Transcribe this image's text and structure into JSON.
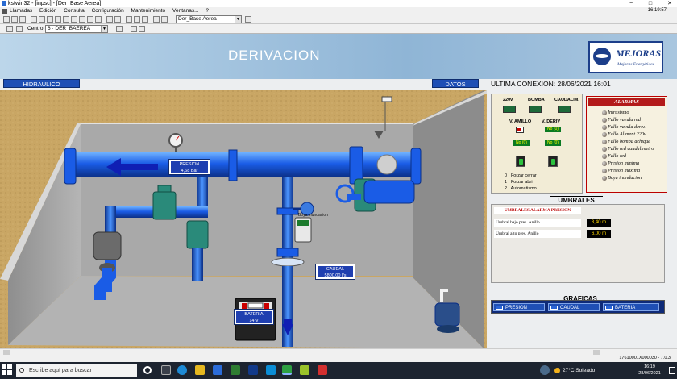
{
  "window": {
    "title": "kstwin32 - [inpsc] - [Der_Base Aerea]",
    "controls": [
      "−",
      "□",
      "✕"
    ]
  },
  "menu": {
    "items": [
      "Llamadas",
      "Edición",
      "Consulta",
      "Configuración",
      "Mantenimiento",
      "Ventanas...",
      "?"
    ],
    "right_status": "16:19:57"
  },
  "toolbar": {
    "screen_combo": "Der_Base Aerea"
  },
  "toolbar2": {
    "centro_label": "Centro:",
    "centro_value": "6 · DER_BAEREA"
  },
  "header": {
    "title": "DERIVACION",
    "logo_name": "MEJORAS",
    "logo_sub": "Mejoras Energéticas"
  },
  "tabs": {
    "hidraulico": "HIDRAULICO",
    "datos": "DATOS"
  },
  "connection": {
    "text": "ULTIMA CONEXION: 28/06/2021 16:01"
  },
  "scene": {
    "presion": {
      "label": "PRESION",
      "value": "4,68 Bar"
    },
    "caudal": {
      "label": "CAUDAL",
      "value": "5800,00 l/s"
    },
    "bateria": {
      "label": "BATERIA",
      "value": "14 V"
    },
    "boya_label": "Boya inundacion"
  },
  "control_panel": {
    "cols": [
      "220v",
      "BOMBA",
      "CAUDALIM."
    ],
    "valve_labels": [
      "V. AMILLO",
      "V. DERIV"
    ],
    "indicators": [
      "No (0)",
      "No (0)",
      "No (0)"
    ],
    "legend": [
      "0 · Forzar cerrar",
      "1 · Forzar abri",
      "2 · Automatismo"
    ]
  },
  "alarms": {
    "title": "ALARMAS",
    "items": [
      "Intrusismo",
      "Fallo vavula red",
      "Fallo vavula deriv.",
      "Fallo Aliment.220v",
      "Fallo bomba achique",
      "Fallo red caudalimetro",
      "Fallo red",
      "Presion minima",
      "Presion maxima",
      "Boya inundacion"
    ]
  },
  "umbrales": {
    "title": "UMBRALES",
    "subtitle": "UMBRALES ALARMA PRESION",
    "rows": [
      {
        "label": "Umbral bajo pres. Anillo",
        "value": "3,40 m"
      },
      {
        "label": "Umbral alto pres. Anillo",
        "value": "6,00 m"
      }
    ]
  },
  "graficas": {
    "title": "GRAFICAS",
    "buttons": [
      "PRESION",
      "CAUDAL",
      "BATERIA"
    ]
  },
  "statusbar": {
    "right": "17610001X000030 - 7.0.3"
  },
  "taskbar": {
    "search_placeholder": "Escribe aquí para buscar",
    "weather": "27°C Soleado",
    "time": "16:19",
    "date": "28/06/2021"
  },
  "colors": {
    "pipe": "#1a5ce6",
    "header_blue": "#1f3fb0",
    "alarm_red": "#b31a1a"
  }
}
